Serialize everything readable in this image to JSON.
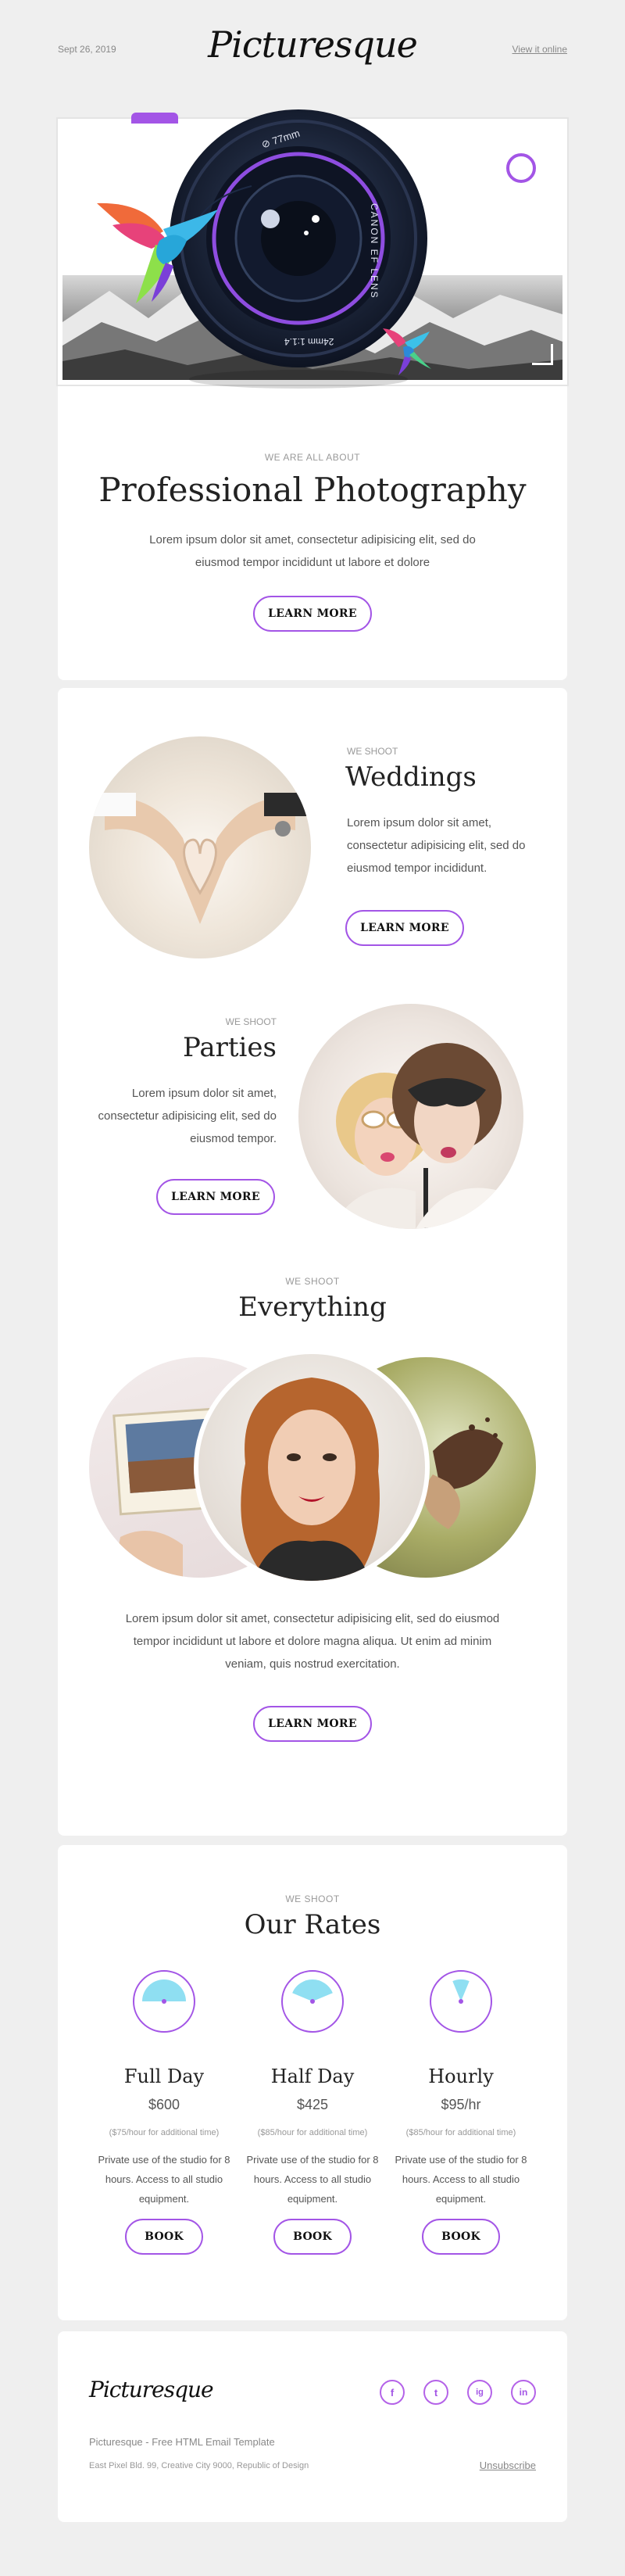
{
  "header": {
    "date": "Sept 26, 2019",
    "logo": "Picturesque",
    "view_online": "View it online"
  },
  "hero": {
    "lens_text_top": "⊘ 77mm",
    "lens_text_side": "CANON EF LENS",
    "lens_text_bottom": "24mm 1:1.4",
    "eyebrow": "WE ARE ALL ABOUT",
    "title": "Professional Photography",
    "text": "Lorem ipsum dolor sit amet, consectetur adipisicing elit, sed do eiusmod tempor incididunt ut labore et dolore",
    "button": "LEARN MORE"
  },
  "shoot": {
    "weddings": {
      "eyebrow": "WE SHOOT",
      "title": "Weddings",
      "text": "Lorem ipsum dolor sit amet, consectetur adipisicing elit, sed do eiusmod tempor incididunt.",
      "button": "LEARN MORE"
    },
    "parties": {
      "eyebrow": "WE SHOOT",
      "title": "Parties",
      "text": "Lorem ipsum dolor sit amet, consectetur adipisicing elit, sed do eiusmod tempor.",
      "button": "LEARN MORE"
    },
    "everything": {
      "eyebrow": "WE SHOOT",
      "title": "Everything",
      "text": "Lorem ipsum dolor sit amet, consectetur adipisicing elit, sed do eiusmod tempor incididunt ut labore et dolore magna aliqua. Ut enim ad minim veniam, quis nostrud exercitation.",
      "button": "LEARN MORE"
    }
  },
  "rates": {
    "eyebrow": "WE SHOOT",
    "title": "Our Rates",
    "items": [
      {
        "name": "Full Day",
        "price": "$600",
        "note": "($75/hour for additional time)",
        "text": "Private use of the studio for 8 hours. Access to all studio equipment.",
        "button": "BOOK",
        "fill": 0.5
      },
      {
        "name": "Half Day",
        "price": "$425",
        "note": "($85/hour for additional time)",
        "text": "Private use of the studio for 8 hours. Access to all studio equipment.",
        "button": "BOOK",
        "fill": 0.375
      },
      {
        "name": "Hourly",
        "price": "$95/hr",
        "note": "($85/hour for additional time)",
        "text": "Private use of the studio for 8 hours. Access to all studio equipment.",
        "button": "BOOK",
        "fill": 0.125
      }
    ]
  },
  "footer": {
    "logo": "Picturesque",
    "social": [
      "f",
      "t",
      "ig",
      "in"
    ],
    "tagline": "Picturesque - Free HTML Email Template",
    "address": "East Pixel Bld. 99, Creative City 9000, Republic of Design",
    "unsubscribe": "Unsubscribe"
  },
  "colors": {
    "accent": "#a355e6",
    "background": "#efefef",
    "card": "#ffffff"
  }
}
